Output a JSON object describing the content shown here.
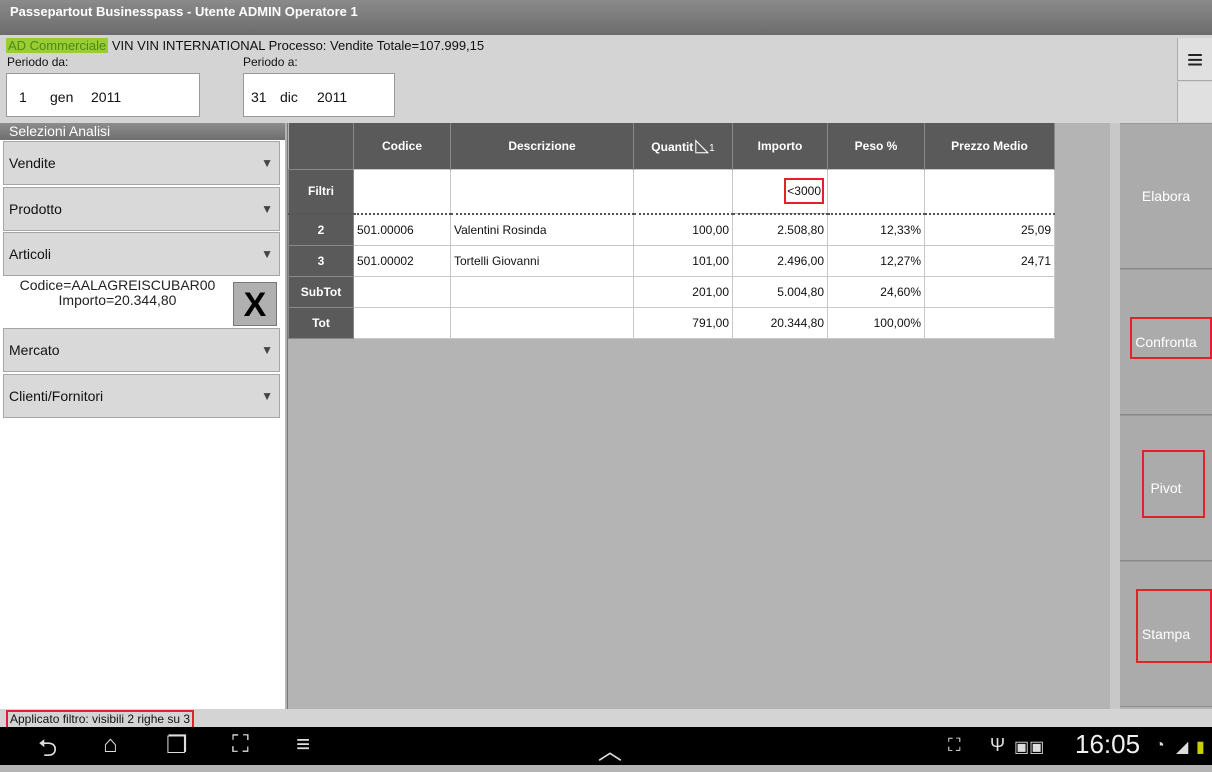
{
  "titlebar": {
    "title": "Passepartout Businesspass - Utente ADMIN Operatore 1"
  },
  "info": {
    "module": "AD Commerciale",
    "details": "VIN VIN INTERNATIONAL Processo: Vendite Totale=107.999,15"
  },
  "period": {
    "from_label": "Periodo da:",
    "to_label": "Periodo a:",
    "from": {
      "day": "1",
      "month": "gen",
      "year": "2011"
    },
    "to": {
      "day": "31",
      "month": "dic",
      "year": "2011"
    }
  },
  "menu_icon": "hamburger-menu-icon",
  "sidebar": {
    "header": "Selezioni Analisi",
    "items": [
      {
        "label": "Vendite"
      },
      {
        "label": "Prodotto"
      },
      {
        "label": "Articoli"
      },
      {
        "label": "Mercato"
      },
      {
        "label": "Clienti/Fornitori"
      }
    ],
    "dropdown_arrow": "▼",
    "active_filter": {
      "line1": "Codice=AALAGREISCUBAR00",
      "line2": "Importo=20.344,80",
      "remove_label": "X"
    }
  },
  "table": {
    "columns": [
      "Codice",
      "Descrizione",
      "Quantit",
      "Importo",
      "Peso %",
      "Prezzo Medio"
    ],
    "sort_indicator": "1",
    "filter_row_label": "Filtri",
    "filter_value": "<3000",
    "rows": [
      {
        "id": "2",
        "codice": "501.00006",
        "descrizione": "Valentini Rosinda",
        "quantita": "100,00",
        "importo": "2.508,80",
        "peso": "12,33%",
        "prezzo": "25,09"
      },
      {
        "id": "3",
        "codice": "501.00002",
        "descrizione": "Tortelli Giovanni",
        "quantita": "101,00",
        "importo": "2.496,00",
        "peso": "12,27%",
        "prezzo": "24,71"
      },
      {
        "id": "SubTot",
        "codice": "",
        "descrizione": "",
        "quantita": "201,00",
        "importo": "5.004,80",
        "peso": "24,60%",
        "prezzo": ""
      },
      {
        "id": "Tot",
        "codice": "",
        "descrizione": "",
        "quantita": "791,00",
        "importo": "20.344,80",
        "peso": "100,00%",
        "prezzo": ""
      }
    ]
  },
  "actions": {
    "elabora": "Elabora",
    "confronta": "Confronta",
    "pivot": "Pivot",
    "stampa": "Stampa"
  },
  "status": {
    "text": "Applicato filtro: visibili 2 righe su 3"
  },
  "system": {
    "clock": "16:05",
    "accent": "#e2222a"
  }
}
